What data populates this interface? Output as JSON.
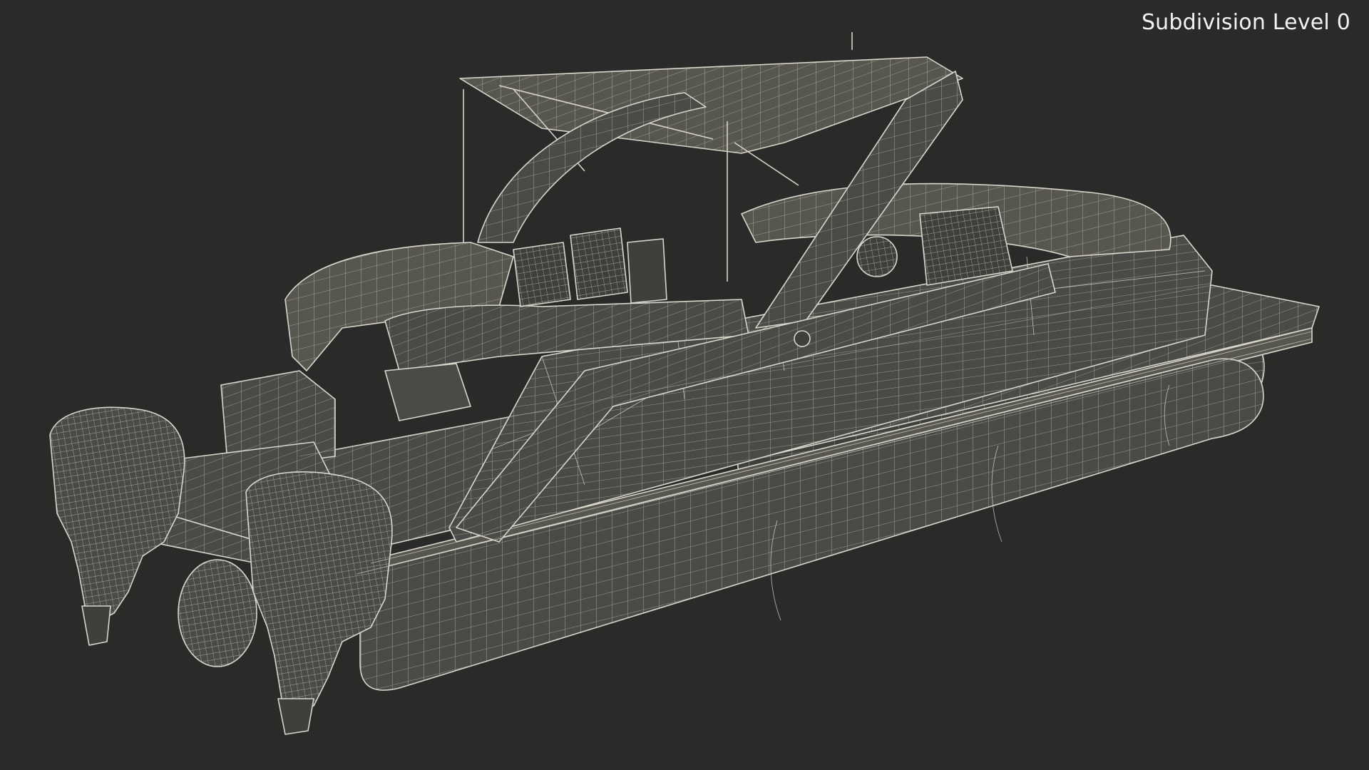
{
  "viewport": {
    "overlay_label": "Subdivision Level 0",
    "background_color": "#2a2a29",
    "wire_color": "#d9d7cc",
    "surface_color": "#4a4a46"
  },
  "model": {
    "render_mode": "wireframe-on-shaded"
  }
}
